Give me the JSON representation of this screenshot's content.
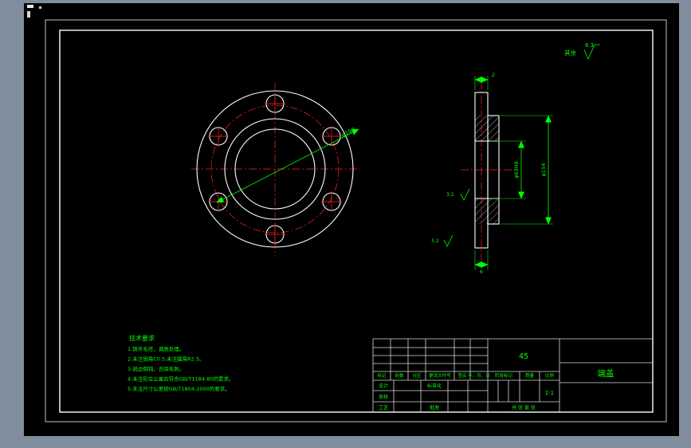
{
  "colors": {
    "background": "#7f8d9c",
    "canvas": "#000000",
    "object_line": "#ffffff",
    "center_line": "#ff2020",
    "dimension": "#00ff00"
  },
  "surface_note": {
    "prefix": "其余",
    "value": "6.3"
  },
  "front_view": {
    "bolt_circle_dim": "φ190"
  },
  "side_view": {
    "top_dim": "2",
    "bottom_dim": "6",
    "bore_dim": "φ62H8",
    "hub_dim": "φ154",
    "finish_bore": "3.2",
    "finish_face": "3.2"
  },
  "tech_requirements": {
    "title": "技术要求",
    "items": [
      "1.铸件毛坯，调质处理。",
      "2.未注倒角C0.5,未注圆角R2.5。",
      "3.锐边倒钝，去除毛刺。",
      "4.未注形位公差应符合GB/T1184-80的要求。",
      "5.未注尺寸公差按GB/T1804-2000的要求。"
    ]
  },
  "title_block": {
    "material": "45",
    "part_name": "端盖",
    "scale": "2:1",
    "rev_headers": [
      "标记",
      "处数",
      "分区",
      "更改文件号",
      "签名",
      "年、月、日"
    ],
    "labels": {
      "design": "设计",
      "standardization": "标准化",
      "stage_mark": "阶段标记",
      "weight": "质量",
      "scale_label": "比例",
      "check": "审核",
      "process": "工艺",
      "approve": "批准",
      "sheets": "共  张  第  张"
    }
  }
}
